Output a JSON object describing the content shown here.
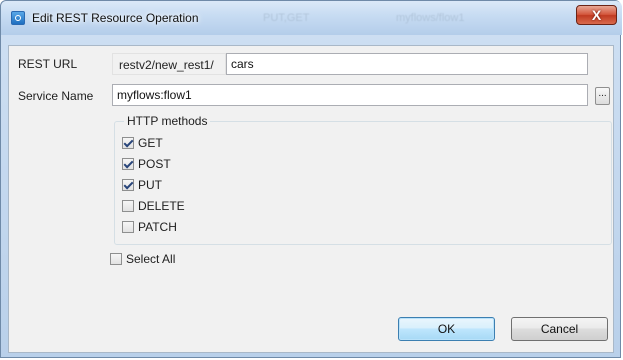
{
  "window": {
    "title": "Edit REST Resource Operation",
    "ghost_title_1": "PUT,GET",
    "ghost_title_2": "myflows/flow1",
    "close_label": "X"
  },
  "form": {
    "rest_url_label": "REST URL",
    "rest_url_prefix": "restv2/new_rest1/",
    "rest_url_value": "cars",
    "service_name_label": "Service Name",
    "service_name_value": "myflows:flow1",
    "browse_label": "..."
  },
  "http_methods": {
    "title": "HTTP methods",
    "items": [
      {
        "label": "GET",
        "checked": true
      },
      {
        "label": "POST",
        "checked": true
      },
      {
        "label": "PUT",
        "checked": true
      },
      {
        "label": "DELETE",
        "checked": false
      },
      {
        "label": "PATCH",
        "checked": false
      }
    ]
  },
  "select_all": {
    "label": "Select All",
    "checked": false
  },
  "buttons": {
    "ok": "OK",
    "cancel": "Cancel"
  }
}
